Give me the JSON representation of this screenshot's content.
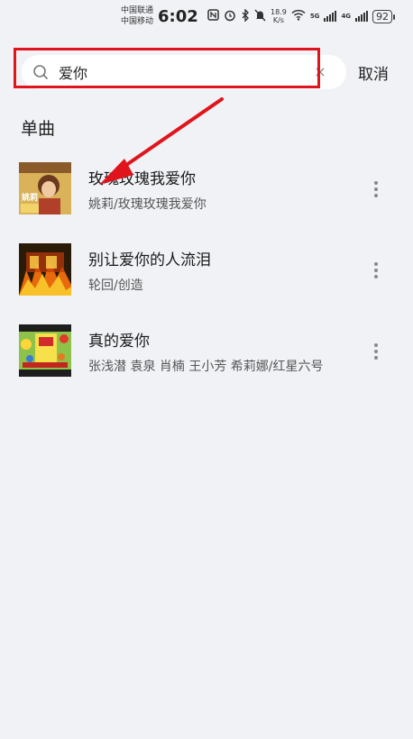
{
  "status_bar": {
    "carrier_1": "中国联通",
    "carrier_2": "中国移动",
    "time": "6:02",
    "net_speed_value": "18.9",
    "net_speed_unit": "K/s",
    "signal_1_tag": "5G",
    "signal_2_tag": "4G",
    "battery": "92"
  },
  "search": {
    "value": "爱你",
    "cancel_label": "取消"
  },
  "section": {
    "title": "单曲"
  },
  "songs": [
    {
      "title": "玫瑰玫瑰我爱你",
      "artist": "姚莉/玫瑰玫瑰我爱你",
      "cover_text": "姚莉"
    },
    {
      "title": "别让爱你的人流泪",
      "artist": "轮回/创造",
      "cover_text": ""
    },
    {
      "title": "真的爱你",
      "artist": "张浅潜 袁泉 肖楠 王小芳 希莉娜/红星六号",
      "cover_text": ""
    }
  ],
  "colors": {
    "background": "#f0f2f6",
    "highlight": "#e0141c"
  }
}
